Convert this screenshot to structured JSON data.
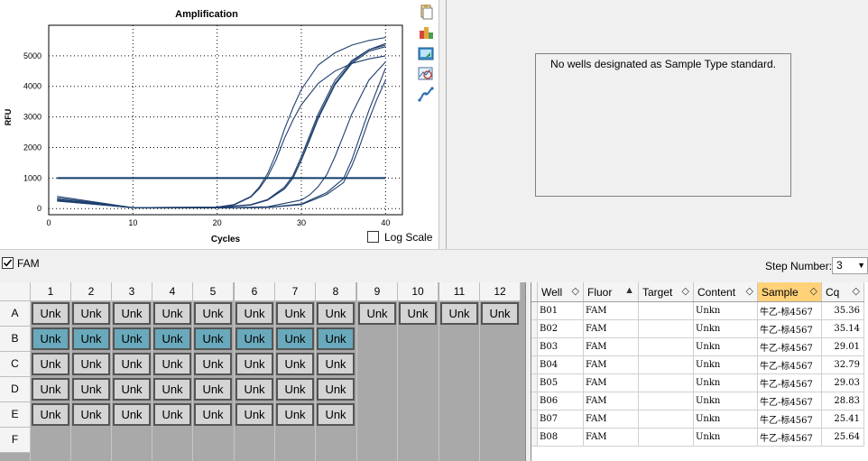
{
  "chart_data": {
    "type": "line",
    "title": "Amplification",
    "xlabel": "Cycles",
    "ylabel": "RFU",
    "xlim": [
      0,
      42
    ],
    "ylim": [
      -200,
      6000
    ],
    "xticks": [
      0,
      10,
      20,
      30,
      40
    ],
    "yticks": [
      0,
      1000,
      2000,
      3000,
      4000,
      5000
    ],
    "threshold": 1000,
    "line_color": "#1f3f6e",
    "threshold_color": "#0f3b68",
    "grid": "dotted",
    "series": [
      {
        "well": "B01",
        "cq": 35.36,
        "plateau": 5300,
        "x": [
          1,
          10,
          20,
          26,
          30,
          33,
          35,
          36,
          37,
          38,
          39,
          40
        ],
        "y": [
          250,
          30,
          20,
          40,
          130,
          460,
          850,
          1400,
          2100,
          2900,
          3600,
          4200
        ]
      },
      {
        "well": "B02",
        "cq": 35.14,
        "plateau": 5500,
        "x": [
          1,
          10,
          20,
          26,
          30,
          33,
          35,
          36,
          37,
          38,
          39,
          40
        ],
        "y": [
          300,
          30,
          20,
          40,
          150,
          520,
          980,
          1600,
          2400,
          3200,
          3900,
          4600
        ]
      },
      {
        "well": "B03",
        "cq": 29.01,
        "plateau": 5600,
        "x": [
          1,
          10,
          20,
          24,
          26,
          28,
          29,
          30,
          31,
          32,
          34,
          36,
          38,
          40
        ],
        "y": [
          350,
          30,
          40,
          120,
          280,
          650,
          1000,
          1600,
          2300,
          3000,
          4100,
          4800,
          5200,
          5400
        ]
      },
      {
        "well": "B04",
        "cq": 32.79,
        "plateau": 5400,
        "x": [
          1,
          10,
          20,
          26,
          30,
          31,
          32,
          33,
          34,
          35,
          36,
          38,
          40
        ],
        "y": [
          280,
          30,
          20,
          60,
          280,
          450,
          720,
          1100,
          1700,
          2400,
          3100,
          4200,
          4800
        ]
      },
      {
        "well": "B05",
        "cq": 29.03,
        "plateau": 5500,
        "x": [
          1,
          10,
          20,
          24,
          26,
          28,
          29,
          30,
          31,
          32,
          34,
          36,
          38,
          40
        ],
        "y": [
          300,
          30,
          40,
          120,
          280,
          640,
          1000,
          1580,
          2250,
          2950,
          4050,
          4750,
          5150,
          5300
        ]
      },
      {
        "well": "B06",
        "cq": 28.83,
        "plateau": 5600,
        "x": [
          1,
          10,
          20,
          24,
          26,
          28,
          29,
          30,
          31,
          32,
          34,
          36,
          38,
          40
        ],
        "y": [
          400,
          30,
          40,
          130,
          300,
          700,
          1080,
          1700,
          2400,
          3100,
          4200,
          4850,
          5200,
          5350
        ]
      },
      {
        "well": "B07",
        "cq": 25.41,
        "plateau": 5700,
        "x": [
          1,
          10,
          20,
          22,
          24,
          25,
          26,
          27,
          28,
          29,
          30,
          32,
          34,
          36,
          38,
          40
        ],
        "y": [
          300,
          30,
          50,
          130,
          400,
          700,
          1150,
          1800,
          2600,
          3300,
          3900,
          4700,
          5100,
          5350,
          5500,
          5600
        ]
      },
      {
        "well": "B08",
        "cq": 25.64,
        "plateau": 5000,
        "x": [
          1,
          10,
          20,
          22,
          24,
          25,
          26,
          27,
          28,
          29,
          30,
          32,
          34,
          36,
          38,
          40
        ],
        "y": [
          250,
          30,
          50,
          120,
          380,
          650,
          1050,
          1600,
          2300,
          2900,
          3400,
          4100,
          4500,
          4750,
          4900,
          5000
        ]
      }
    ]
  },
  "amp_panel": {
    "log_scale_label": "Log Scale",
    "log_scale_checked": false
  },
  "std_panel": {
    "message": "No wells designated as Sample Type standard."
  },
  "fluor": {
    "label": "FAM",
    "checked": true
  },
  "step": {
    "label": "Step Number:",
    "value": "3"
  },
  "plate": {
    "columns": [
      "1",
      "2",
      "3",
      "4",
      "5",
      "6",
      "7",
      "8",
      "9",
      "10",
      "11",
      "12"
    ],
    "rows": [
      "A",
      "B",
      "C",
      "D",
      "E",
      "F"
    ],
    "well_label": "Unk",
    "filled": {
      "A": 12,
      "B": 8,
      "C": 8,
      "D": 8,
      "E": 8,
      "F": 0
    },
    "selected_row": "B",
    "selected_color": "#69a9bb"
  },
  "table": {
    "headers": [
      "Well",
      "Fluor",
      "Target",
      "Content",
      "Sample",
      "Cq"
    ],
    "sorted_column": "Sample",
    "rows": [
      [
        "B01",
        "FAM",
        "",
        "Unkn",
        "牛乙-标4567",
        "35.36"
      ],
      [
        "B02",
        "FAM",
        "",
        "Unkn",
        "牛乙-标4567",
        "35.14"
      ],
      [
        "B03",
        "FAM",
        "",
        "Unkn",
        "牛乙-标4567",
        "29.01"
      ],
      [
        "B04",
        "FAM",
        "",
        "Unkn",
        "牛乙-标4567",
        "32.79"
      ],
      [
        "B05",
        "FAM",
        "",
        "Unkn",
        "牛乙-标4567",
        "29.03"
      ],
      [
        "B06",
        "FAM",
        "",
        "Unkn",
        "牛乙-标4567",
        "28.83"
      ],
      [
        "B07",
        "FAM",
        "",
        "Unkn",
        "牛乙-标4567",
        "25.41"
      ],
      [
        "B08",
        "FAM",
        "",
        "Unkn",
        "牛乙-标4567",
        "25.64"
      ]
    ]
  },
  "toolbar_icons": [
    "copy-icon",
    "export-icon",
    "save-image-icon",
    "zoom-chart-icon",
    "chart-settings-icon"
  ]
}
